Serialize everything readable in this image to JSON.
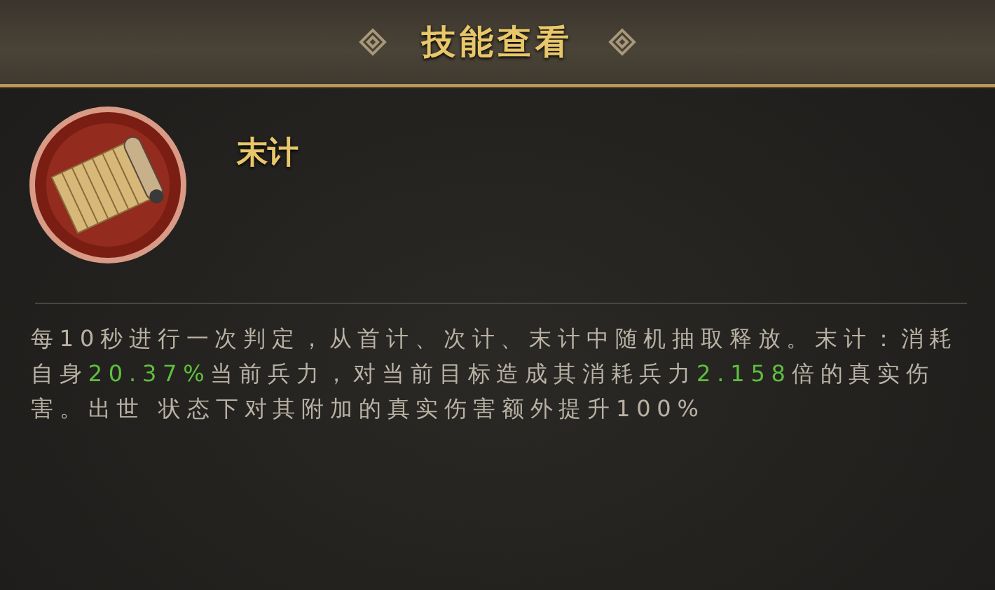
{
  "header": {
    "title": "技能查看"
  },
  "skill": {
    "name": "末计"
  },
  "description": [
    {
      "text": "每10秒进行一次判定，从首计、次计、末计中随机抽取释放。末计：消耗自身",
      "highlight": false
    },
    {
      "text": "20.37%",
      "highlight": true
    },
    {
      "text": "当前兵力，对当前目标造成其消耗兵力",
      "highlight": false
    },
    {
      "text": "2.158",
      "highlight": true
    },
    {
      "text": "倍的真实伤害。出世 状态下对其附加的真实伤害额外提升100%",
      "highlight": false
    }
  ]
}
